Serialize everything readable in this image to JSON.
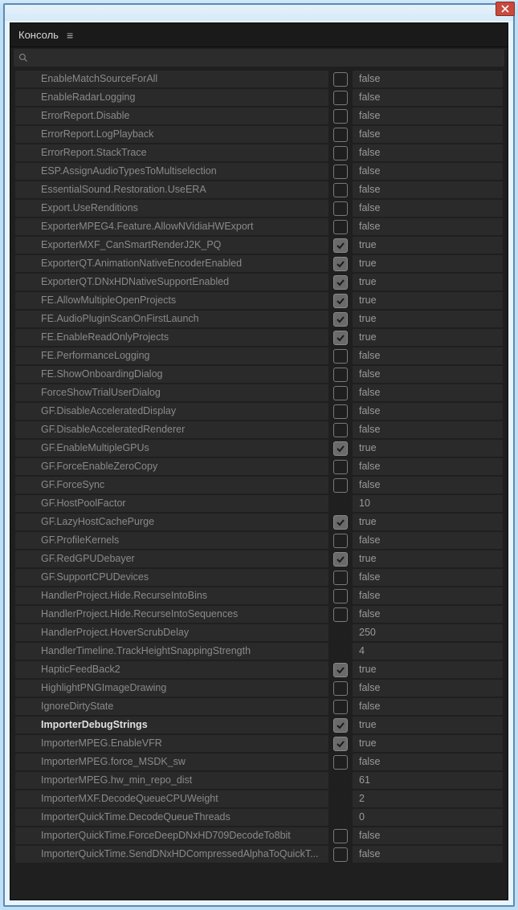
{
  "window": {
    "title": "Консоль"
  },
  "search": {
    "placeholder": ""
  },
  "rows": [
    {
      "label": "EnableMatchSourceForAll",
      "checked": false,
      "hasCheckbox": true,
      "value": "false",
      "highlighted": false
    },
    {
      "label": "EnableRadarLogging",
      "checked": false,
      "hasCheckbox": true,
      "value": "false",
      "highlighted": false
    },
    {
      "label": "ErrorReport.Disable",
      "checked": false,
      "hasCheckbox": true,
      "value": "false",
      "highlighted": false
    },
    {
      "label": "ErrorReport.LogPlayback",
      "checked": false,
      "hasCheckbox": true,
      "value": "false",
      "highlighted": false
    },
    {
      "label": "ErrorReport.StackTrace",
      "checked": false,
      "hasCheckbox": true,
      "value": "false",
      "highlighted": false
    },
    {
      "label": "ESP.AssignAudioTypesToMultiselection",
      "checked": false,
      "hasCheckbox": true,
      "value": "false",
      "highlighted": false
    },
    {
      "label": "EssentialSound.Restoration.UseERA",
      "checked": false,
      "hasCheckbox": true,
      "value": "false",
      "highlighted": false
    },
    {
      "label": "Export.UseRenditions",
      "checked": false,
      "hasCheckbox": true,
      "value": "false",
      "highlighted": false
    },
    {
      "label": "ExporterMPEG4.Feature.AllowNVidiaHWExport",
      "checked": false,
      "hasCheckbox": true,
      "value": "false",
      "highlighted": false
    },
    {
      "label": "ExporterMXF_CanSmartRenderJ2K_PQ",
      "checked": true,
      "hasCheckbox": true,
      "value": "true",
      "highlighted": false
    },
    {
      "label": "ExporterQT.AnimationNativeEncoderEnabled",
      "checked": true,
      "hasCheckbox": true,
      "value": "true",
      "highlighted": false
    },
    {
      "label": "ExporterQT.DNxHDNativeSupportEnabled",
      "checked": true,
      "hasCheckbox": true,
      "value": "true",
      "highlighted": false
    },
    {
      "label": "FE.AllowMultipleOpenProjects",
      "checked": true,
      "hasCheckbox": true,
      "value": "true",
      "highlighted": false
    },
    {
      "label": "FE.AudioPluginScanOnFirstLaunch",
      "checked": true,
      "hasCheckbox": true,
      "value": "true",
      "highlighted": false
    },
    {
      "label": "FE.EnableReadOnlyProjects",
      "checked": true,
      "hasCheckbox": true,
      "value": "true",
      "highlighted": false
    },
    {
      "label": "FE.PerformanceLogging",
      "checked": false,
      "hasCheckbox": true,
      "value": "false",
      "highlighted": false
    },
    {
      "label": "FE.ShowOnboardingDialog",
      "checked": false,
      "hasCheckbox": true,
      "value": "false",
      "highlighted": false
    },
    {
      "label": "ForceShowTrialUserDialog",
      "checked": false,
      "hasCheckbox": true,
      "value": "false",
      "highlighted": false
    },
    {
      "label": "GF.DisableAcceleratedDisplay",
      "checked": false,
      "hasCheckbox": true,
      "value": "false",
      "highlighted": false
    },
    {
      "label": "GF.DisableAcceleratedRenderer",
      "checked": false,
      "hasCheckbox": true,
      "value": "false",
      "highlighted": false
    },
    {
      "label": "GF.EnableMultipleGPUs",
      "checked": true,
      "hasCheckbox": true,
      "value": "true",
      "highlighted": false
    },
    {
      "label": "GF.ForceEnableZeroCopy",
      "checked": false,
      "hasCheckbox": true,
      "value": "false",
      "highlighted": false
    },
    {
      "label": "GF.ForceSync",
      "checked": false,
      "hasCheckbox": true,
      "value": "false",
      "highlighted": false
    },
    {
      "label": "GF.HostPoolFactor",
      "checked": false,
      "hasCheckbox": false,
      "value": "10",
      "highlighted": false
    },
    {
      "label": "GF.LazyHostCachePurge",
      "checked": true,
      "hasCheckbox": true,
      "value": "true",
      "highlighted": false
    },
    {
      "label": "GF.ProfileKernels",
      "checked": false,
      "hasCheckbox": true,
      "value": "false",
      "highlighted": false
    },
    {
      "label": "GF.RedGPUDebayer",
      "checked": true,
      "hasCheckbox": true,
      "value": "true",
      "highlighted": false
    },
    {
      "label": "GF.SupportCPUDevices",
      "checked": false,
      "hasCheckbox": true,
      "value": "false",
      "highlighted": false
    },
    {
      "label": "HandlerProject.Hide.RecurseIntoBins",
      "checked": false,
      "hasCheckbox": true,
      "value": "false",
      "highlighted": false
    },
    {
      "label": "HandlerProject.Hide.RecurseIntoSequences",
      "checked": false,
      "hasCheckbox": true,
      "value": "false",
      "highlighted": false
    },
    {
      "label": "HandlerProject.HoverScrubDelay",
      "checked": false,
      "hasCheckbox": false,
      "value": "250",
      "highlighted": false
    },
    {
      "label": "HandlerTimeline.TrackHeightSnappingStrength",
      "checked": false,
      "hasCheckbox": false,
      "value": "4",
      "highlighted": false
    },
    {
      "label": "HapticFeedBack2",
      "checked": true,
      "hasCheckbox": true,
      "value": "true",
      "highlighted": false
    },
    {
      "label": "HighlightPNGImageDrawing",
      "checked": false,
      "hasCheckbox": true,
      "value": "false",
      "highlighted": false
    },
    {
      "label": "IgnoreDirtyState",
      "checked": false,
      "hasCheckbox": true,
      "value": "false",
      "highlighted": false
    },
    {
      "label": "ImporterDebugStrings",
      "checked": true,
      "hasCheckbox": true,
      "value": "true",
      "highlighted": true
    },
    {
      "label": "ImporterMPEG.EnableVFR",
      "checked": true,
      "hasCheckbox": true,
      "value": "true",
      "highlighted": false
    },
    {
      "label": "ImporterMPEG.force_MSDK_sw",
      "checked": false,
      "hasCheckbox": true,
      "value": "false",
      "highlighted": false
    },
    {
      "label": "ImporterMPEG.hw_min_repo_dist",
      "checked": false,
      "hasCheckbox": false,
      "value": "61",
      "highlighted": false
    },
    {
      "label": "ImporterMXF.DecodeQueueCPUWeight",
      "checked": false,
      "hasCheckbox": false,
      "value": "2",
      "highlighted": false
    },
    {
      "label": "ImporterQuickTime.DecodeQueueThreads",
      "checked": false,
      "hasCheckbox": false,
      "value": "0",
      "highlighted": false
    },
    {
      "label": "ImporterQuickTime.ForceDeepDNxHD709DecodeTo8bit",
      "checked": false,
      "hasCheckbox": true,
      "value": "false",
      "highlighted": false
    },
    {
      "label": "ImporterQuickTime.SendDNxHDCompressedAlphaToQuickT...",
      "checked": false,
      "hasCheckbox": true,
      "value": "false",
      "highlighted": false
    }
  ]
}
